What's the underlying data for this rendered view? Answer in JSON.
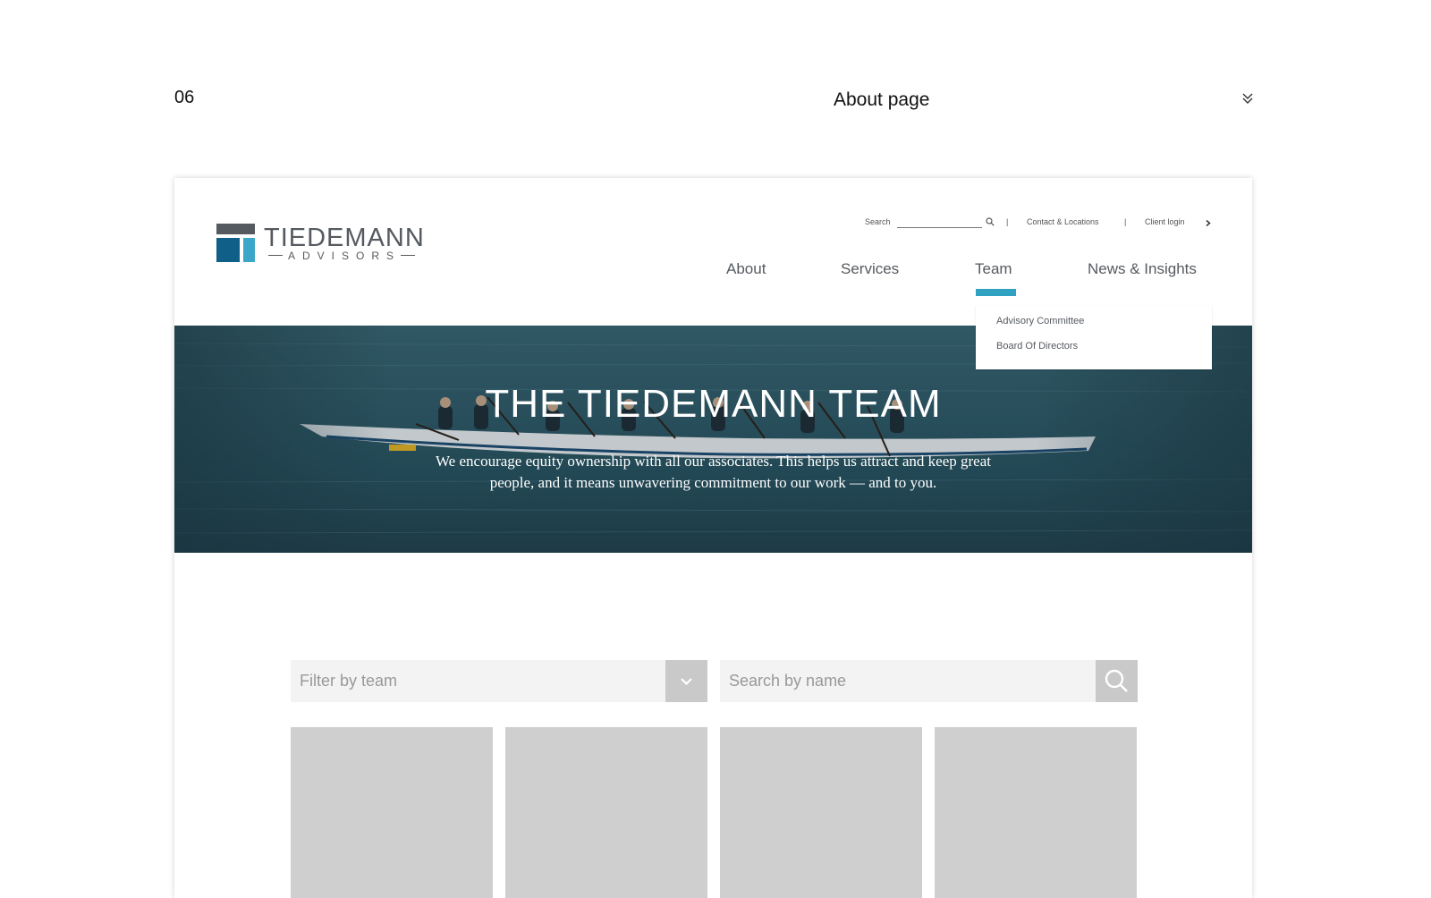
{
  "slide": {
    "number": "06",
    "title": "About page"
  },
  "site": {
    "logo": {
      "word": "TIEDEMANN",
      "sub": "ADVISORS"
    },
    "utility": {
      "search_label": "Search",
      "separator": "|",
      "contact": "Contact & Locations",
      "login": "Client login"
    },
    "nav": {
      "items": [
        "About",
        "Services",
        "Team",
        "News & Insights"
      ],
      "active": "Team"
    },
    "dropdown": {
      "items": [
        "Advisory Committee",
        "Board Of Directors"
      ]
    },
    "hero": {
      "title": "THE TIEDEMANN TEAM",
      "text": "We encourage equity ownership with all our associates. This helps us attract and keep great people, and it means unwavering commitment to our work — and to you."
    },
    "filters": {
      "team_placeholder": "Filter by team",
      "name_placeholder": "Search by name"
    },
    "colors": {
      "accent": "#2fa2c2",
      "logo_dark": "#0f5f88",
      "logo_light": "#3aa7c8",
      "logo_grey": "#555a60",
      "placeholder_card": "#cfcfcf"
    },
    "icons": {
      "collapse": "double-chevron-down-icon",
      "search": "search-icon",
      "login_arrow": "chevron-right-icon",
      "dropdown_arrow": "chevron-down-icon"
    }
  }
}
